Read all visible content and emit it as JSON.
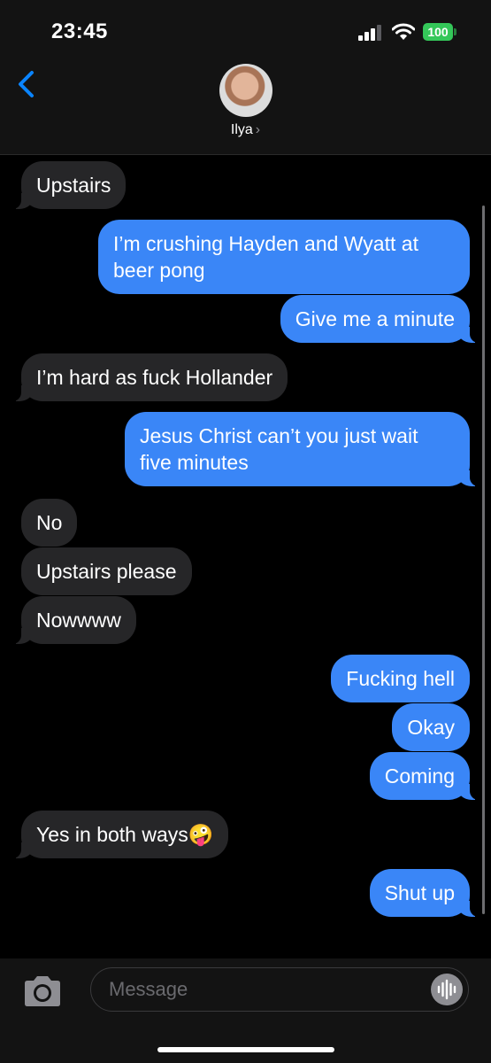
{
  "status_bar": {
    "time": "23:45",
    "battery": "100"
  },
  "header": {
    "contact_name": "Ilya",
    "chevron": "›"
  },
  "messages": [
    {
      "side": "in",
      "text": "Upstairs"
    },
    {
      "side": "out",
      "text": "I’m crushing Hayden and Wyatt at beer pong"
    },
    {
      "side": "out",
      "text": "Give me a minute"
    },
    {
      "side": "in",
      "text": "I’m hard as fuck Hollander"
    },
    {
      "side": "out",
      "text": "Jesus Christ can’t you just wait five minutes"
    },
    {
      "side": "in",
      "text": "No"
    },
    {
      "side": "in",
      "text": "Upstairs please"
    },
    {
      "side": "in",
      "text": "Nowwww"
    },
    {
      "side": "out",
      "text": "Fucking hell"
    },
    {
      "side": "out",
      "text": "Okay"
    },
    {
      "side": "out",
      "text": "Coming"
    },
    {
      "side": "in",
      "text": "Yes in both ways🤪"
    },
    {
      "side": "out",
      "text": "Shut up"
    }
  ],
  "composer": {
    "placeholder": "Message"
  },
  "icons": {
    "back": "chevron-left-icon",
    "camera": "camera-icon",
    "voice": "waveform-icon"
  },
  "colors": {
    "outgoing": "#3a86f7",
    "incoming": "#262628",
    "accent": "#0a84ff",
    "battery": "#34c759"
  }
}
